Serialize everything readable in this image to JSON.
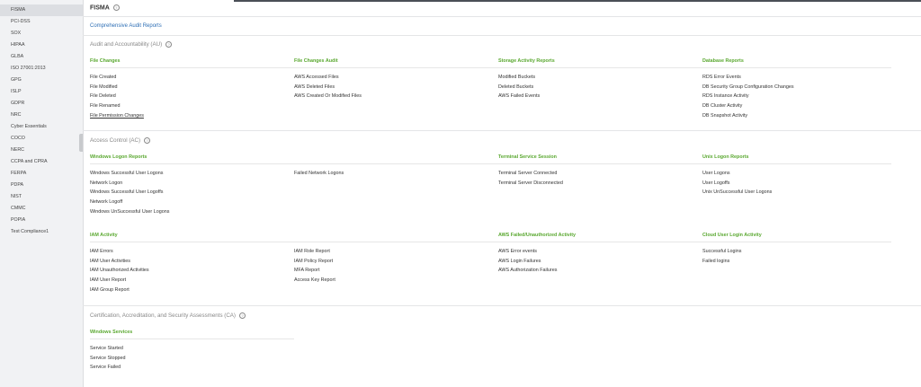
{
  "sidebar": {
    "items": [
      "FISMA",
      "PCI-DSS",
      "SOX",
      "HIPAA",
      "GLBA",
      "ISO 27001:2013",
      "GPG",
      "ISLP",
      "GDPR",
      "NRC",
      "Cyber Essentials",
      "COCO",
      "NERC",
      "CCPA and CPRA",
      "FERPA",
      "PDPA",
      "NIST",
      "CMMC",
      "POPIA",
      "Test Compliance1"
    ],
    "active": "FISMA"
  },
  "header": {
    "title": "FISMA",
    "help_icon": "question-circle-icon"
  },
  "link": "Comprehensive Audit Reports",
  "sections": [
    {
      "title": "Audit and Accountability (AU)",
      "groups": [
        {
          "title": "File Changes",
          "items": [
            "File Created",
            "File Modified",
            "File Deleted",
            "File Renamed",
            "File Permission Changes"
          ]
        },
        {
          "title": "File Changes Audit",
          "items": [
            "AWS Accessed Files",
            "AWS Deleted Files",
            "AWS Created Or Modified Files"
          ]
        },
        {
          "title": "Storage Activity Reports",
          "items": [
            "Modified Buckets",
            "Deleted Buckets",
            "AWS Failed Events"
          ]
        },
        {
          "title": "Database Reports",
          "items": [
            "RDS Error Events",
            "DB Security Group Configuration Changes",
            "RDS Instance Activity",
            "DB Cluster Activity",
            "DB Snapshot Activity"
          ]
        }
      ]
    },
    {
      "title": "Access Control (AC)",
      "groups": [
        {
          "title": "Windows Logon Reports",
          "items": [
            "Windows Successful User Logons",
            "Network Logon",
            "Windows Successful User Logoffs",
            "Network Logoff",
            "Windows UnSuccessful User Logons"
          ]
        },
        {
          "title": "",
          "items": [
            "Failed Network Logons"
          ]
        },
        {
          "title": "Terminal Service Session",
          "items": [
            "Terminal Server Connected",
            "Terminal Server Disconnected"
          ]
        },
        {
          "title": "Unix Logon Reports",
          "items": [
            "User Logons",
            "User Logoffs",
            "Unix UnSuccessful User Logons"
          ]
        },
        {
          "title": "IAM Activity",
          "items": [
            "IAM Errors",
            "IAM User Activities",
            "IAM Unauthorized Activities",
            "IAM User Report",
            "IAM Group Report"
          ]
        },
        {
          "title": "",
          "items": [
            "IAM Role Report",
            "IAM Policy Report",
            "MFA Report",
            "Access Key Report"
          ]
        },
        {
          "title": "AWS Failed/Unauthorized Activity",
          "items": [
            "AWS Error events",
            "AWS Login Failures",
            "AWS Authorization Failures"
          ]
        },
        {
          "title": "Cloud User Login Activity",
          "items": [
            "Successful Logins",
            "Failed logins"
          ]
        }
      ]
    },
    {
      "title": "Certification, Accreditation, and Security Assessments (CA)",
      "groups": [
        {
          "title": "Windows Services",
          "items": [
            "Service Started",
            "Service Stopped",
            "Service Failed"
          ]
        }
      ]
    }
  ]
}
